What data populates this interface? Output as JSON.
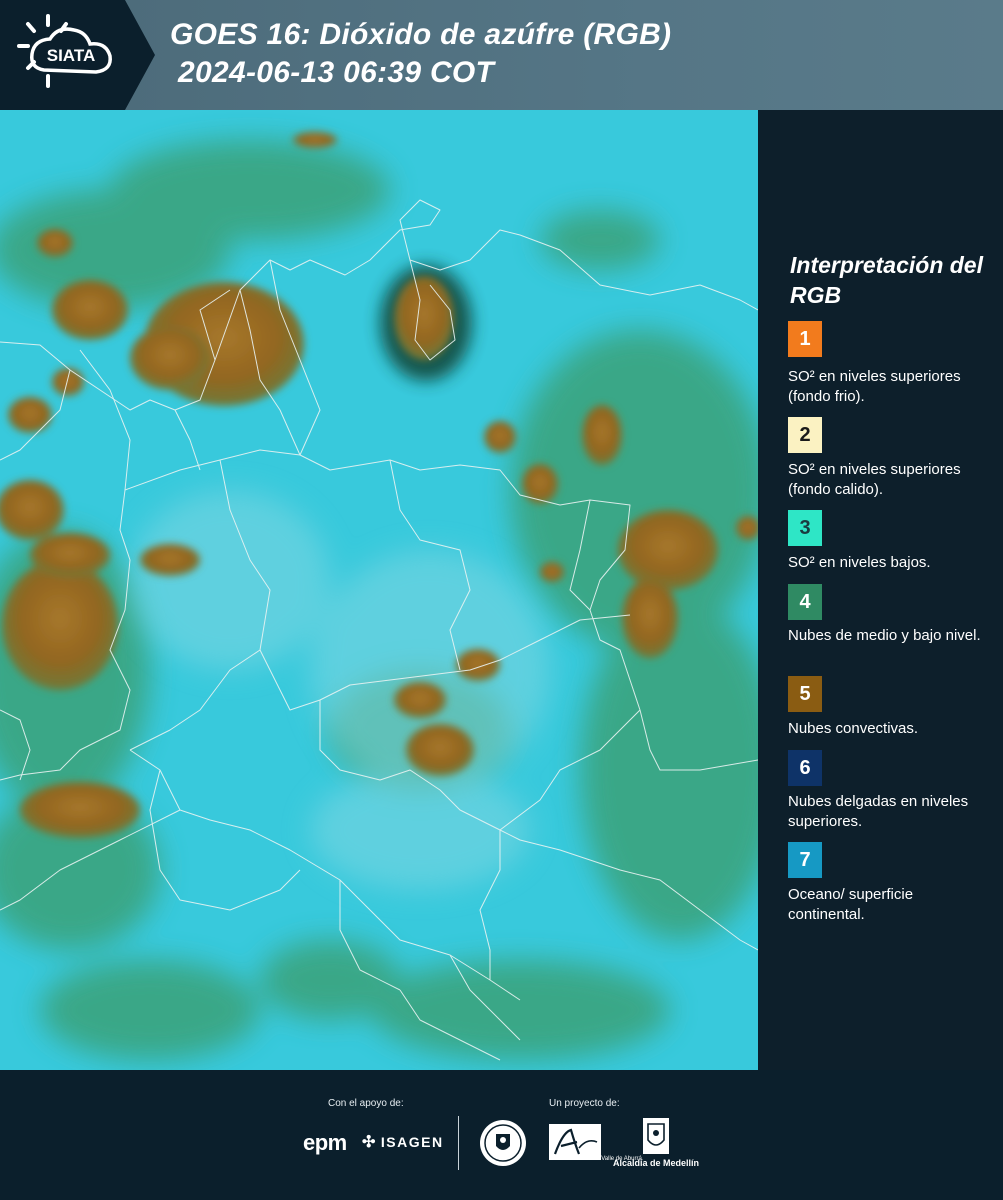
{
  "header": {
    "logo_text": "SIATA",
    "title": "GOES 16: Dióxido de azúfre (RGB)",
    "timestamp": "2024-06-13 06:39 COT"
  },
  "legend": {
    "title": "Interpretación del RGB",
    "items": [
      {
        "number": "1",
        "color": "#f27b1d",
        "text_color": "#ffffff",
        "label": "SO² en niveles superiores (fondo frio)."
      },
      {
        "number": "2",
        "color": "#fbf2c2",
        "text_color": "#1a1a1a",
        "label": "SO² en niveles superiores (fondo calido)."
      },
      {
        "number": "3",
        "color": "#2ee6c6",
        "text_color": "#1a3b40",
        "label": "SO² en niveles bajos."
      },
      {
        "number": "4",
        "color": "#2f8a63",
        "text_color": "#ffffff",
        "label": "Nubes de medio y bajo nivel."
      },
      {
        "number": "5",
        "color": "#8a5c12",
        "text_color": "#ffffff",
        "label": "Nubes convectivas."
      },
      {
        "number": "6",
        "color": "#0e3368",
        "text_color": "#ffffff",
        "label": "Nubes delgadas en niveles superiores."
      },
      {
        "number": "7",
        "color": "#1699c4",
        "text_color": "#ffffff",
        "label": "Oceano/ superficie continental."
      }
    ]
  },
  "footer": {
    "support_label": "Con el apoyo de:",
    "project_label": "Un proyecto de:",
    "sponsor_epm": "epm",
    "sponsor_isagen": "ISAGEN",
    "area_metropolitana": "METROPOLITANA Valle de Aburrá",
    "alcaldia": "Alcaldía de Medellín"
  }
}
